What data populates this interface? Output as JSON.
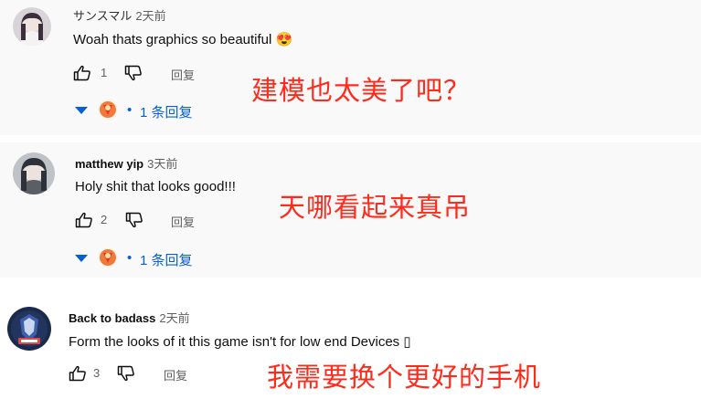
{
  "comments": [
    {
      "username": "サンスマル",
      "time": "2天前",
      "text": "Woah thats graphics so beautiful 😍",
      "likes": "1",
      "reply_label": "回复",
      "replies": "1 条回复",
      "replies_dot": "•",
      "annotation": "建模也太美了吧？"
    },
    {
      "username": "matthew yip",
      "time": "3天前",
      "text": "Holy shit that looks good!!!",
      "likes": "2",
      "reply_label": "回复",
      "replies": "1 条回复",
      "replies_dot": "•",
      "annotation": "天哪看起来真吊"
    },
    {
      "username": "Back to badass",
      "time": "2天前",
      "text": "Form the looks of it this game isn't for low end Devices ▯",
      "likes": "3",
      "reply_label": "回复",
      "annotation": "我需要换个更好的手机"
    }
  ],
  "colors": {
    "annotation": "#ff2a1a",
    "link": "#065fd4",
    "secondary_text": "#606060",
    "panel_bg": "#f9f9f9"
  },
  "icons": [
    "thumb-up-icon",
    "thumb-down-icon",
    "caret-down-icon"
  ]
}
